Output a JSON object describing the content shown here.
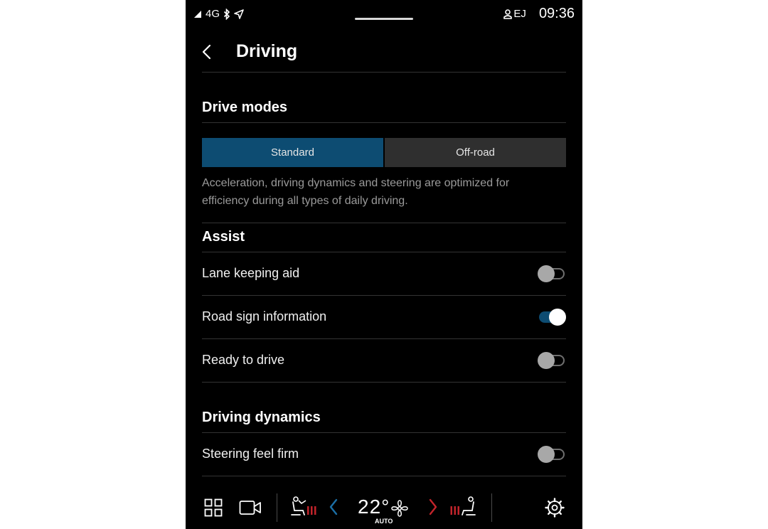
{
  "status_bar": {
    "network": "4G",
    "signal_icon": "signal-icon",
    "bluetooth_icon": "bluetooth-icon",
    "location_icon": "location-arrow-icon",
    "user_icon": "user-icon",
    "user_initials": "EJ",
    "time": "09:36"
  },
  "header": {
    "back_icon": "chevron-left-icon",
    "title": "Driving"
  },
  "drive_modes": {
    "title": "Drive modes",
    "options": [
      "Standard",
      "Off-road"
    ],
    "selected": "Standard",
    "description": "Acceleration, driving dynamics and steering are optimized for efficiency during all types of daily driving."
  },
  "assist": {
    "title": "Assist",
    "items": [
      {
        "label": "Lane keeping aid",
        "enabled": false
      },
      {
        "label": "Road sign information",
        "enabled": true
      },
      {
        "label": "Ready to drive",
        "enabled": false
      }
    ]
  },
  "driving_dynamics": {
    "title": "Driving dynamics",
    "items": [
      {
        "label": "Steering feel firm",
        "enabled": false
      }
    ]
  },
  "climate_bar": {
    "apps_icon": "grid-icon",
    "camera_icon": "camera-icon",
    "seat_heat_left_icon": "seat-heat-left-icon",
    "temp_down_icon": "chevron-left-icon",
    "temperature": "22°",
    "fan_icon": "fan-icon",
    "mode": "AUTO",
    "temp_up_icon": "chevron-right-icon",
    "seat_heat_right_icon": "seat-heat-right-icon",
    "settings_icon": "gear-icon",
    "colors": {
      "temp_down": "#1b6fa6",
      "temp_up": "#c2242b",
      "seat_heat": "#c2242b",
      "accent": "#0d4c72"
    }
  }
}
